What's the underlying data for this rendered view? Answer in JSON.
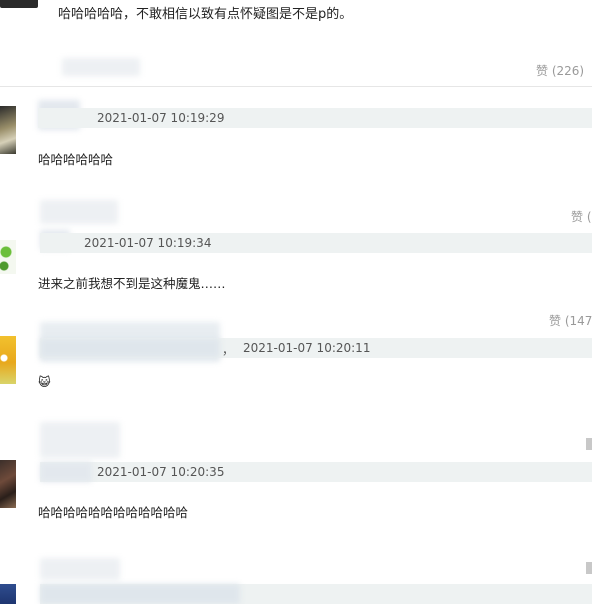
{
  "top_comment": {
    "text": "哈哈哈哈哈，不敢相信以致有点怀疑图是不是p的。",
    "like_label": "赞",
    "like_count": "(226)"
  },
  "comments": [
    {
      "time": "2021-01-07 10:19:29",
      "text": "哈哈哈哈哈哈"
    },
    {
      "time": "2021-01-07 10:19:34",
      "text": "进来之前我想不到是这种魔鬼……",
      "like_label": "赞",
      "like_count": "("
    },
    {
      "name_suffix": "，",
      "time": "2021-01-07 10:20:11",
      "text": "😺",
      "like_label": "赞",
      "like_count": "(147"
    },
    {
      "time": "2021-01-07 10:20:35",
      "text": "哈哈哈哈哈哈哈哈哈哈哈哈"
    }
  ]
}
